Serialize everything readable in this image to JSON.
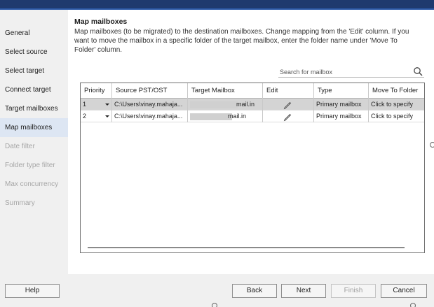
{
  "sidebar": {
    "items": [
      {
        "label": "General",
        "state": "normal"
      },
      {
        "label": "Select source",
        "state": "normal"
      },
      {
        "label": "Select target",
        "state": "normal"
      },
      {
        "label": "Connect target",
        "state": "normal"
      },
      {
        "label": "Target mailboxes",
        "state": "normal"
      },
      {
        "label": "Map mailboxes",
        "state": "active"
      },
      {
        "label": "Date filter",
        "state": "disabled"
      },
      {
        "label": "Folder type filter",
        "state": "disabled"
      },
      {
        "label": "Max concurrency",
        "state": "disabled"
      },
      {
        "label": "Summary",
        "state": "disabled"
      }
    ]
  },
  "main": {
    "title": "Map mailboxes",
    "description": "Map mailboxes (to be migrated) to the destination mailboxes. Change mapping from the 'Edit' column. If you want to move the mailbox in a specific folder of the target mailbox, enter the folder name under 'Move To Folder' column."
  },
  "search": {
    "placeholder": "Search for mailbox",
    "icon": "search-icon"
  },
  "table": {
    "columns": [
      "Priority",
      "Source PST/OST",
      "Target Mailbox",
      "Edit",
      "Type",
      "Move To Folder"
    ],
    "rows": [
      {
        "priority": "1",
        "source": "C:\\Users\\vinay.mahaja...",
        "target_suffix": "mail.in",
        "type": "Primary mailbox",
        "move_to": "Click to specify",
        "selected": true
      },
      {
        "priority": "2",
        "source": "C:\\Users\\vinay.mahaja...",
        "target_suffix": "mail.in",
        "type": "Primary mailbox",
        "move_to": "Click to specify",
        "selected": false
      }
    ]
  },
  "buttons": {
    "help": "Help",
    "back": "Back",
    "next": "Next",
    "finish": "Finish",
    "cancel": "Cancel"
  },
  "colors": {
    "title_bar": "#1f3a6e",
    "active_nav": "#dde6f3",
    "selected_row": "#d4d4d4",
    "disabled_text": "#a6a6a6"
  }
}
